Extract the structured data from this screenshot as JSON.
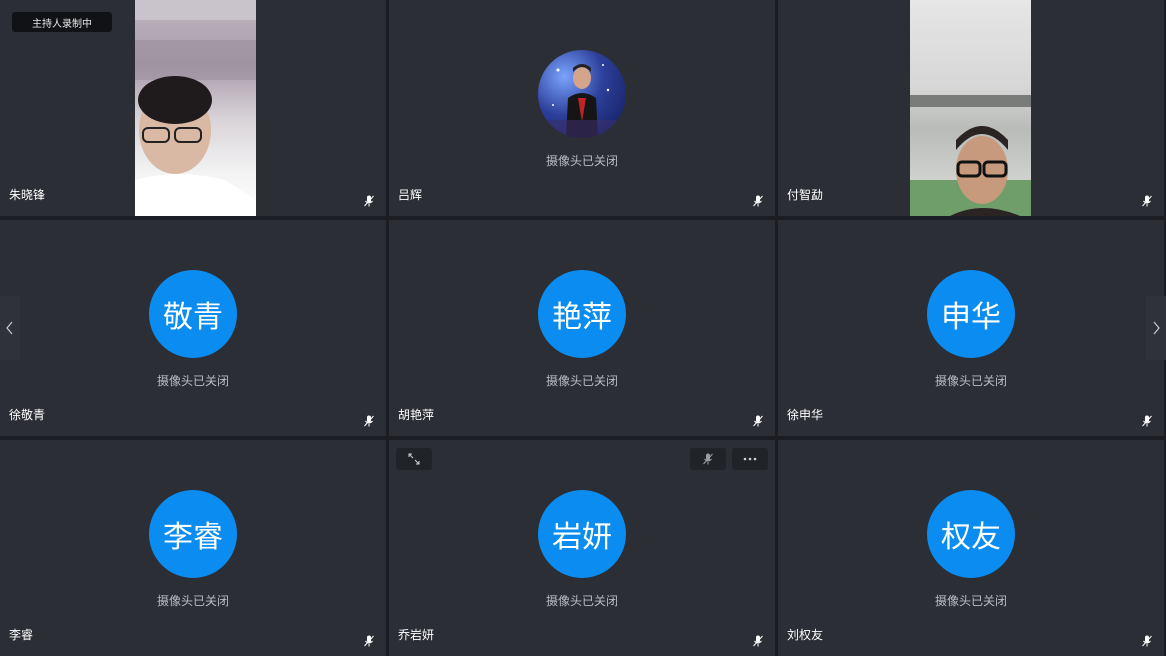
{
  "recording_badge": "主持人录制中",
  "camera_off_text": "摄像头已关闭",
  "tiles": [
    {
      "name": "朱晓锋",
      "type": "video"
    },
    {
      "name": "吕辉",
      "type": "photo-avatar"
    },
    {
      "name": "付智勐",
      "type": "video"
    },
    {
      "name": "徐敬青",
      "avatar_text": "敬青"
    },
    {
      "name": "胡艳萍",
      "avatar_text": "艳萍"
    },
    {
      "name": "徐申华",
      "avatar_text": "申华"
    },
    {
      "name": "李睿",
      "avatar_text": "李睿"
    },
    {
      "name": "乔岩妍",
      "avatar_text": "岩妍"
    },
    {
      "name": "刘权友",
      "avatar_text": "权友"
    }
  ],
  "colors": {
    "avatar_bg": "#0a8cf0",
    "tile_bg": "#2b2e34",
    "page_bg": "#1b1d22"
  },
  "icons": [
    "mic-muted-icon",
    "expand-icon",
    "more-icon",
    "chevron-left-icon",
    "chevron-right-icon"
  ]
}
